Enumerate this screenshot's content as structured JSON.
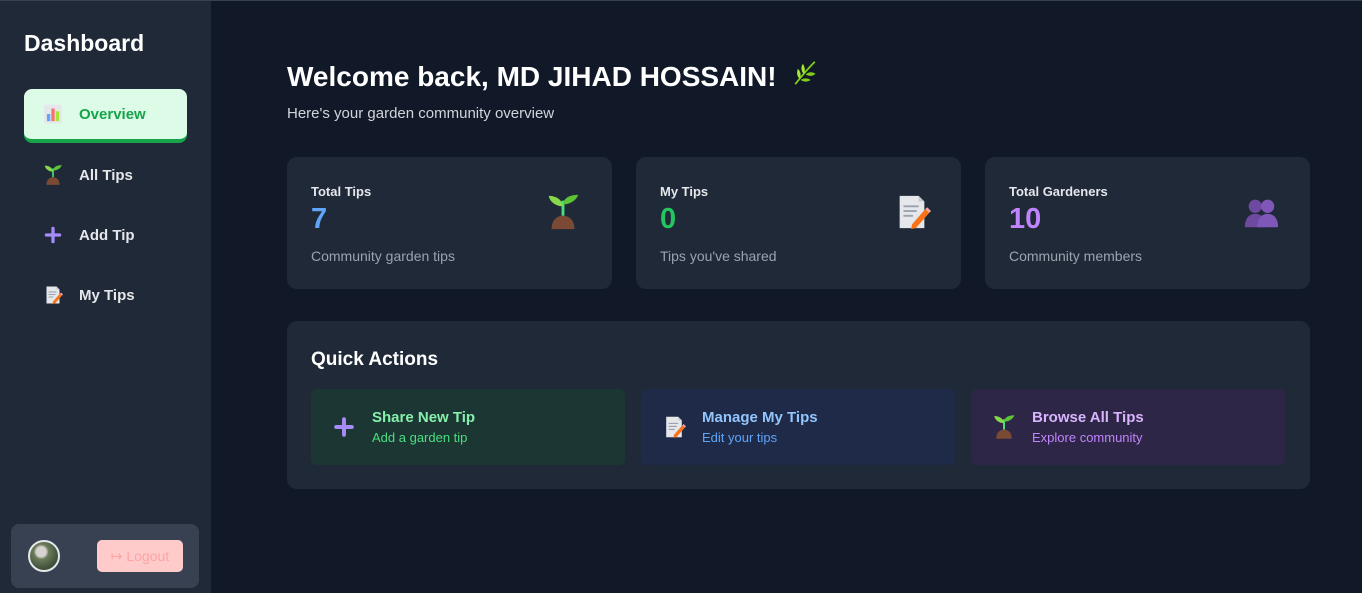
{
  "sidebar": {
    "title": "Dashboard",
    "items": [
      {
        "label": "Overview",
        "icon": "bar-chart-icon",
        "active": true
      },
      {
        "label": "All Tips",
        "icon": "seedling-icon"
      },
      {
        "label": "Add Tip",
        "icon": "plus-icon"
      },
      {
        "label": "My Tips",
        "icon": "memo-icon"
      }
    ],
    "logout_label": "↦ Logout"
  },
  "main": {
    "welcome": "Welcome back, MD JIHAD HOSSAIN!",
    "welcome_icon": "herb-icon",
    "subtitle": "Here's your garden community overview",
    "stats": [
      {
        "label": "Total Tips",
        "value": "7",
        "desc": "Community garden tips",
        "icon": "seedling-icon",
        "color": "#60a5fa"
      },
      {
        "label": "My Tips",
        "value": "0",
        "desc": "Tips you've shared",
        "icon": "memo-icon",
        "color": "#22c55e"
      },
      {
        "label": "Total Gardeners",
        "value": "10",
        "desc": "Community members",
        "icon": "people-icon",
        "color": "#c084fc"
      }
    ],
    "quick_actions": {
      "title": "Quick Actions",
      "items": [
        {
          "title": "Share New Tip",
          "sub": "Add a garden tip",
          "icon": "plus-icon"
        },
        {
          "title": "Manage My Tips",
          "sub": "Edit your tips",
          "icon": "memo-icon"
        },
        {
          "title": "Browse All Tips",
          "sub": "Explore community",
          "icon": "seedling-icon"
        }
      ]
    }
  }
}
